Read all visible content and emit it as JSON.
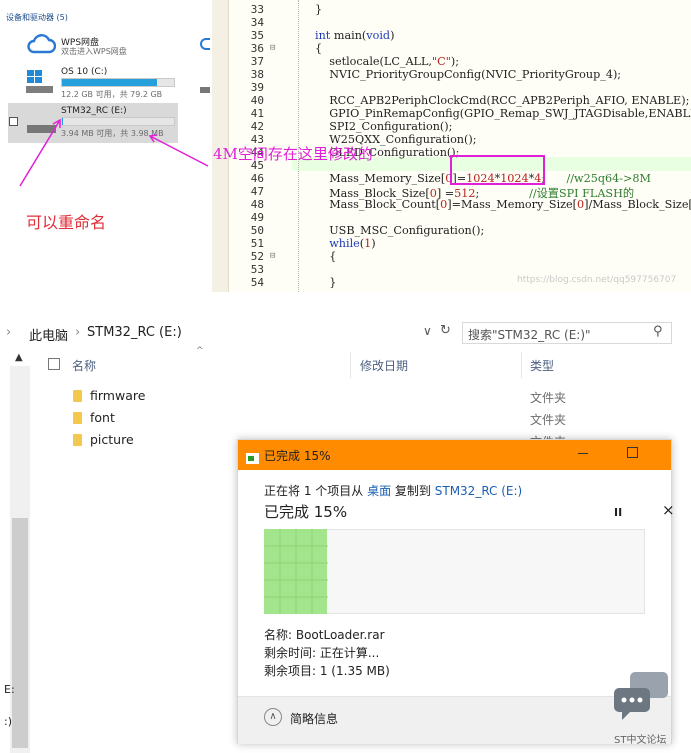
{
  "drives_panel": {
    "group_title": "设备和驱动器 (5)",
    "drives": [
      {
        "name": "WPS网盘",
        "sub": "双击进入WPS网盘"
      },
      {
        "name": "OS 10 (C:)",
        "sub": "12.2 GB 可用，共 79.2 GB",
        "used_fraction": 0.85
      },
      {
        "name": "STM32_RC (E:)",
        "sub": "3.94 MB 可用，共 3.98 MB",
        "used_fraction": 0.01
      }
    ],
    "rename_annotation": "可以重命名"
  },
  "code_panel": {
    "line_numbers": [
      "33",
      "34",
      "35",
      "36",
      "37",
      "38",
      "39",
      "40",
      "41",
      "42",
      "43",
      "44",
      "45",
      "46",
      "47",
      "48",
      "49",
      "50",
      "51",
      "52",
      "53",
      "54"
    ],
    "lines": [
      "}",
      "",
      "int main(void)",
      "{",
      "    setlocale(LC_ALL,\"C\");",
      "    NVIC_PriorityGroupConfig(NVIC_PriorityGroup_4);",
      "",
      "    RCC_APB2PeriphClockCmd(RCC_APB2Periph_AFIO, ENABLE);",
      "    GPIO_PinRemapConfig(GPIO_Remap_SWJ_JTAGDisable,ENABLE);",
      "    SPI2_Configuration();",
      "    W25QXX_Configuration();",
      "    OLED_Configuration();",
      "",
      "    Mass_Memory_Size[0]=1024*1024*4;      //w25q64->8M",
      "    Mass_Block_Size[0] =512;              //设置SPI FLASH的",
      "    Mass_Block_Count[0]=Mass_Memory_Size[0]/Mass_Block_Size[0];",
      "",
      "    USB_MSC_Configuration();",
      "    while(1)",
      "    {",
      "",
      "    }"
    ],
    "annotation": "4M空间存在这里修改的",
    "watermark": "https://blog.csdn.net/qq597756707"
  },
  "explorer": {
    "breadcrumb": [
      "此电脑",
      "STM32_RC (E:)"
    ],
    "search_placeholder": "搜索\"STM32_RC (E:)\"",
    "columns": {
      "name": "名称",
      "date": "修改日期",
      "type": "类型"
    },
    "files": [
      {
        "name": "firmware",
        "type": "文件夹"
      },
      {
        "name": "font",
        "type": "文件夹"
      },
      {
        "name": "picture",
        "type": "文件夹"
      }
    ],
    "left_labels": [
      "E:",
      ":)"
    ]
  },
  "copy_dialog": {
    "title": "已完成 15%",
    "line1_prefix": "正在将 1 个项目从 ",
    "from": "桌面",
    "line1_mid": " 复制到 ",
    "to": "STM32_RC (E:)",
    "progress_text": "已完成 15%",
    "progress_fraction": 0.15,
    "pause_label": "II",
    "close_label": "×",
    "name_line": "名称: BootLoader.rar",
    "time_line": "剩余时间: 正在计算...",
    "items_line": "剩余项目: 1 (1.35 MB)",
    "details_label": "简略信息"
  },
  "forum_logo_text": "ST中文论坛",
  "colors": {
    "accent_orange": "#ff8c00",
    "annotation_magenta": "#e020d8",
    "annotation_red": "#e0303a",
    "progress_green": "#a3e58c"
  }
}
